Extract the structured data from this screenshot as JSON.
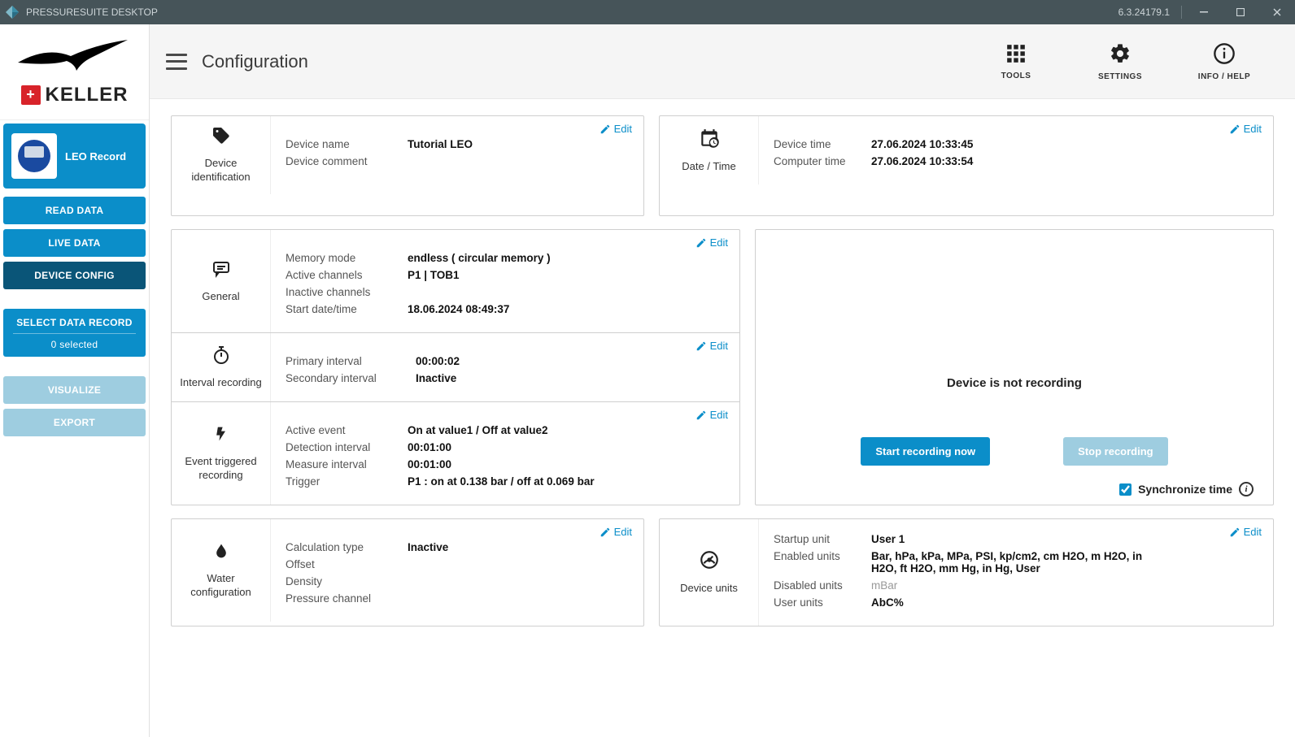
{
  "titlebar": {
    "app_name": "PRESSURESUITE DESKTOP",
    "version": "6.3.24179.1"
  },
  "sidebar": {
    "brand": "KELLER",
    "device_name": "LEO Record",
    "buttons": {
      "read_data": "READ DATA",
      "live_data": "LIVE DATA",
      "device_config": "DEVICE CONFIG",
      "select_data": "SELECT DATA RECORD",
      "selected_count": "0 selected",
      "visualize": "VISUALIZE",
      "export": "EXPORT"
    }
  },
  "topbar": {
    "page_title": "Configuration",
    "tools": "TOOLS",
    "settings": "SETTINGS",
    "info_help": "INFO / HELP"
  },
  "labels": {
    "edit": "Edit"
  },
  "cards": {
    "device_id": {
      "title": "Device identification",
      "k_name": "Device name",
      "v_name": "Tutorial LEO",
      "k_comment": "Device comment",
      "v_comment": ""
    },
    "datetime": {
      "title": "Date / Time",
      "k_device": "Device time",
      "v_device": "27.06.2024 10:33:45",
      "k_computer": "Computer time",
      "v_computer": "27.06.2024 10:33:54"
    },
    "general": {
      "title": "General",
      "k_mem": "Memory mode",
      "v_mem": "endless ( circular memory )",
      "k_active": "Active channels",
      "v_active": "P1 | TOB1",
      "k_inactive": "Inactive channels",
      "v_inactive": "",
      "k_start": "Start date/time",
      "v_start": "18.06.2024 08:49:37"
    },
    "interval": {
      "title": "Interval recording",
      "k_primary": "Primary interval",
      "v_primary": "00:00:02",
      "k_secondary": "Secondary interval",
      "v_secondary": "Inactive"
    },
    "event": {
      "title": "Event triggered recording",
      "k_active": "Active event",
      "v_active": "On at value1 / Off at value2",
      "k_detect": "Detection interval",
      "v_detect": "00:01:00",
      "k_measure": "Measure interval",
      "v_measure": "00:01:00",
      "k_trigger": "Trigger",
      "v_trigger": "P1 :  on at 0.138 bar / off at 0.069 bar"
    },
    "record": {
      "status": "Device is not recording",
      "start": "Start recording now",
      "stop": "Stop recording",
      "sync": "Synchronize time"
    },
    "water": {
      "title": "Water configuration",
      "k_calc": "Calculation type",
      "v_calc": "Inactive",
      "k_offset": "Offset",
      "v_offset": "",
      "k_density": "Density",
      "v_density": "",
      "k_pch": "Pressure channel",
      "v_pch": ""
    },
    "units": {
      "title": "Device units",
      "k_startup": "Startup unit",
      "v_startup": "User 1",
      "k_enabled": "Enabled units",
      "v_enabled": "Bar, hPa, kPa, MPa, PSI, kp/cm2, cm H2O, m H2O, in H2O, ft H2O, mm Hg, in Hg, User",
      "k_disabled": "Disabled units",
      "v_disabled": "mBar",
      "k_user": "User units",
      "v_user": "AbC%"
    }
  }
}
